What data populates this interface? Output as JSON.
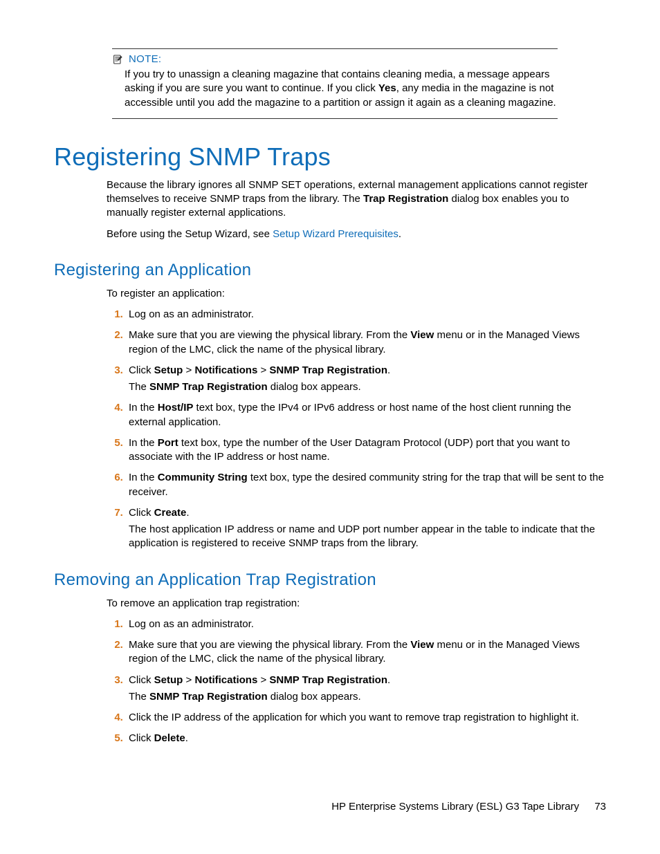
{
  "note": {
    "label": "NOTE:",
    "body_pre": "If you try to unassign a cleaning magazine that contains cleaning media, a message appears asking if you are sure you want to continue. If you click ",
    "body_bold": "Yes",
    "body_post": ", any media in the magazine is not accessible until you add the magazine to a partition or assign it again as a cleaning magazine."
  },
  "h1": "Registering SNMP Traps",
  "intro1_pre": "Because the library ignores all SNMP SET operations, external management applications cannot register themselves to receive SNMP traps from the library. The ",
  "intro1_bold": "Trap Registration",
  "intro1_post": " dialog box enables you to manually register external applications.",
  "intro2_pre": "Before using the Setup Wizard, see ",
  "intro2_link": "Setup Wizard Prerequisites",
  "intro2_post": ".",
  "sectionA": {
    "title": "Registering an Application",
    "lead": "To register an application:",
    "s1": "Log on as an administrator.",
    "s2_pre": "Make sure that you are viewing the physical library. From the ",
    "s2_b1": "View",
    "s2_post": " menu or in the Managed Views region of the LMC, click the name of the physical library.",
    "s3_click": "Click ",
    "s3_setup": "Setup",
    "s3_sep1": " > ",
    "s3_notif": "Notifications",
    "s3_sep2": " > ",
    "s3_snmp": "SNMP Trap Registration",
    "s3_end": ".",
    "s3_line2_pre": "The ",
    "s3_line2_b": "SNMP Trap Registration",
    "s3_line2_post": " dialog box appears.",
    "s4_pre": "In the ",
    "s4_b": "Host/IP",
    "s4_post": " text box, type the IPv4 or IPv6 address or host name of the host client running the external application.",
    "s5_pre": "In the ",
    "s5_b": "Port",
    "s5_post": " text box, type the number of the User Datagram Protocol (UDP) port that you want to associate with the IP address or host name.",
    "s6_pre": "In the ",
    "s6_b": "Community String",
    "s6_post": " text box, type the desired community string for the trap that will be sent to the receiver.",
    "s7_click": "Click ",
    "s7_b": "Create",
    "s7_end": ".",
    "s7_line2": "The host application IP address or name and UDP port number appear in the table to indicate that the application is registered to receive SNMP traps from the library."
  },
  "sectionB": {
    "title": "Removing an Application Trap Registration",
    "lead": "To remove an application trap registration:",
    "s1": "Log on as an administrator.",
    "s2_pre": "Make sure that you are viewing the physical library. From the ",
    "s2_b1": "View",
    "s2_post": " menu or in the Managed Views region of the LMC, click the name of the physical library.",
    "s3_click": "Click ",
    "s3_setup": "Setup",
    "s3_sep1": " > ",
    "s3_notif": "Notifications",
    "s3_sep2": " > ",
    "s3_snmp": "SNMP Trap Registration",
    "s3_end": ".",
    "s3_line2_pre": "The ",
    "s3_line2_b": "SNMP Trap Registration",
    "s3_line2_post": " dialog box appears.",
    "s4": "Click the IP address of the application for which you want to remove trap registration to highlight it.",
    "s5_click": "Click ",
    "s5_b": "Delete",
    "s5_end": "."
  },
  "footer": {
    "text": "HP Enterprise Systems Library (ESL) G3 Tape Library",
    "page": "73"
  }
}
